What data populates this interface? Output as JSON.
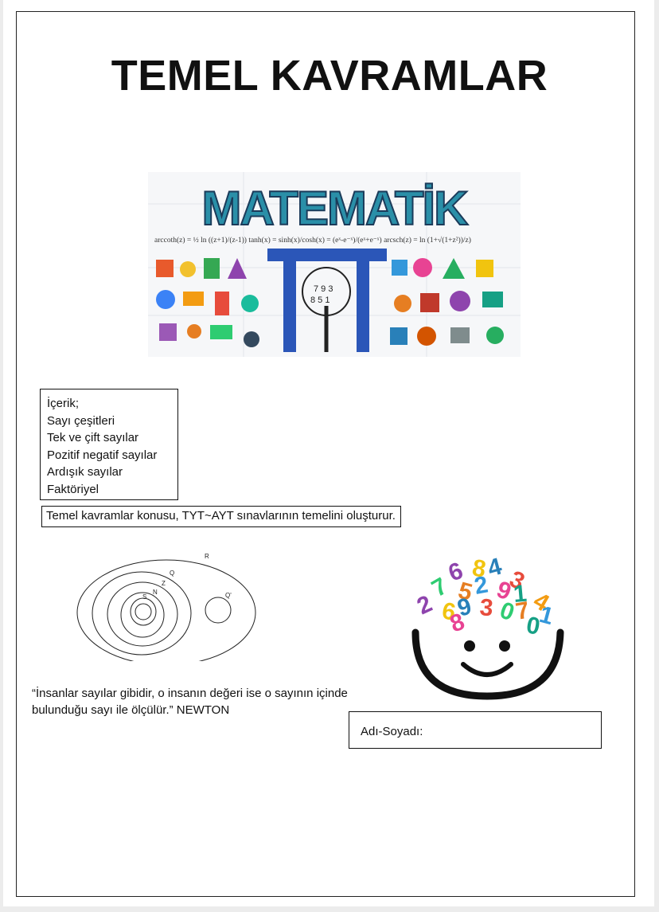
{
  "title": "TEMEL KAVRAMLAR",
  "banner": {
    "word": "MATEMATİK",
    "formula_text": "arccoth(z) = ½ ln ((z+1)/(z-1))  tanh(x) = sinh(x)/cosh(x) = (eˣ-e⁻ˣ)/(eˣ+e⁻ˣ)  arcsch(z) = ln (1+√(1+z²))/z)"
  },
  "contents": {
    "heading": "İçerik;",
    "items": [
      "Sayı çeşitleri",
      "Tek ve çift sayılar",
      "Pozitif negatif sayılar",
      "Ardışık sayılar",
      "Faktöriyel"
    ]
  },
  "note": "Temel kavramlar konusu, TYT~AYT sınavlarının temelini oluşturur.",
  "venn_labels": {
    "r": "R",
    "q": "Q",
    "z": "Z",
    "n": "N",
    "s": "S",
    "q_prime": "Q'"
  },
  "quote": "“İnsanlar sayılar gibidir, o insanın değeri ise o sayının içinde bulunduğu sayı ile ölçülür.” NEWTON",
  "name_label": "Adı-Soyadı:",
  "head_digits": [
    "6",
    "8",
    "4",
    "3",
    "7",
    "5",
    "2",
    "9",
    "1",
    "4",
    "2",
    "6",
    "9",
    "3",
    "0",
    "7",
    "1",
    "8",
    "0"
  ],
  "colors": {
    "text": "#111111",
    "banner_pi": "#2b56b8"
  }
}
